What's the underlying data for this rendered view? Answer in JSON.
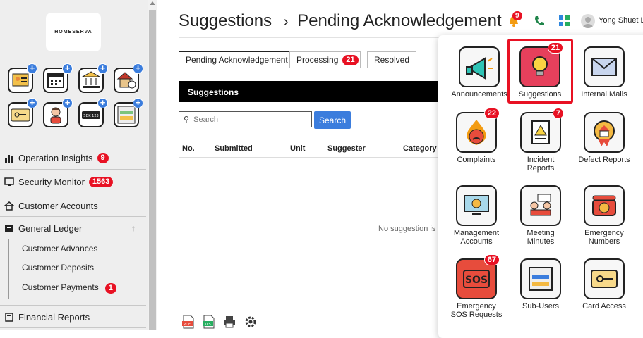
{
  "logo": {
    "text": "HOMESERVA"
  },
  "sidebar": {
    "nav": [
      {
        "label": "Operation Insights",
        "badge": "9"
      },
      {
        "label": "Security Monitor",
        "badge": "1563"
      },
      {
        "label": "Customer Accounts",
        "badge": ""
      },
      {
        "label": "General Ledger",
        "badge": "",
        "expand": "↑"
      },
      {
        "label": "Financial Reports",
        "badge": ""
      }
    ],
    "sub": [
      {
        "label": "Customer Advances",
        "badge": ""
      },
      {
        "label": "Customer Deposits",
        "badge": ""
      },
      {
        "label": "Customer Payments",
        "badge": "1"
      }
    ]
  },
  "header": {
    "title": "Suggestions",
    "separator": "›",
    "subtitle": "Pending Acknowledgement",
    "notif_badge": "9",
    "user": "Yong Shuet L"
  },
  "tabs": [
    {
      "label": "Pending Acknowledgement",
      "badge": ""
    },
    {
      "label": "Processing",
      "badge": "21"
    },
    {
      "label": "Resolved",
      "badge": ""
    }
  ],
  "panel": {
    "title": "Suggestions"
  },
  "search": {
    "placeholder": "Search",
    "button": "Search"
  },
  "table": {
    "columns": [
      "No.",
      "Submitted",
      "Unit",
      "Suggester",
      "Category"
    ]
  },
  "empty_text": "No suggestion is t",
  "apps": [
    {
      "label": "Announcements",
      "badge": ""
    },
    {
      "label": "Suggestions",
      "badge": "21"
    },
    {
      "label": "Internal Mails",
      "badge": ""
    },
    {
      "label": "Complaints",
      "badge": "22"
    },
    {
      "label": "Incident\nReports",
      "badge": "7"
    },
    {
      "label": "Defect Reports",
      "badge": ""
    },
    {
      "label": "Management\nAccounts",
      "badge": ""
    },
    {
      "label": "Meeting\nMinutes",
      "badge": ""
    },
    {
      "label": "Emergency\nNumbers",
      "badge": ""
    },
    {
      "label": "Emergency\nSOS Requests",
      "badge": "67"
    },
    {
      "label": "Sub-Users",
      "badge": ""
    },
    {
      "label": "Card Access",
      "badge": ""
    }
  ],
  "file_icons": [
    "pdf-icon",
    "xls-icon",
    "printer-icon",
    "settings-icon"
  ]
}
